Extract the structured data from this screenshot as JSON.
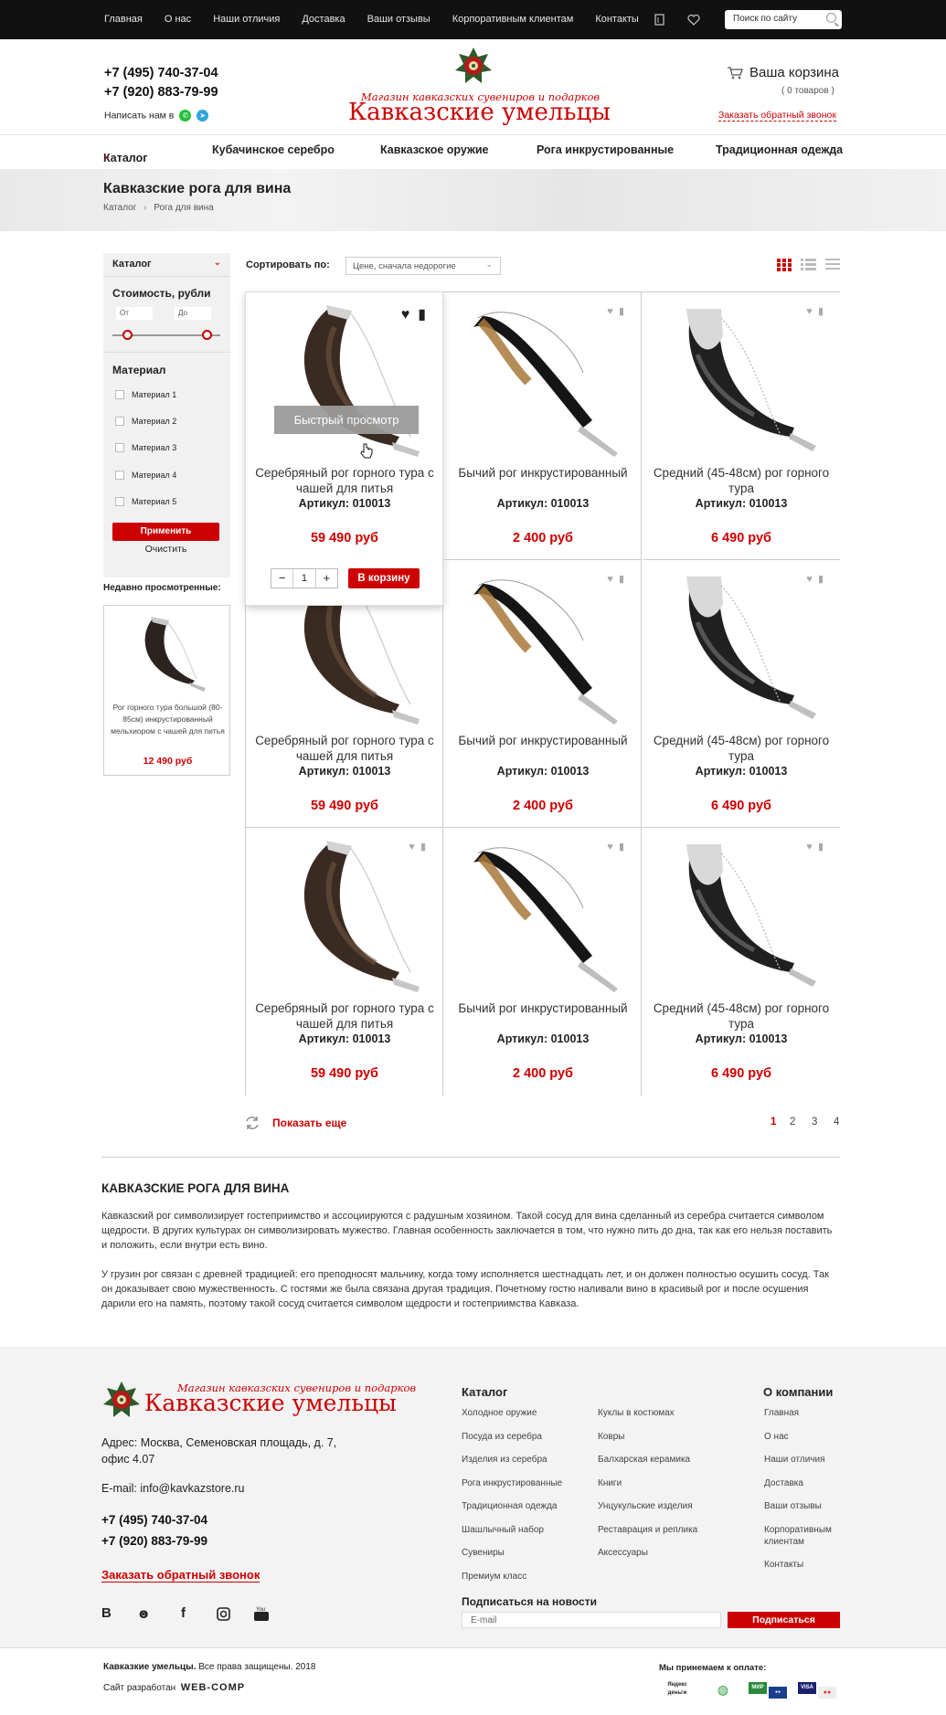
{
  "topnav": [
    "Главная",
    "О нас",
    "Наши отличия",
    "Доставка",
    "Ваши отзывы",
    "Корпоративным клиентам",
    "Контакты"
  ],
  "search": {
    "placeholder": "Поиск по сайту"
  },
  "header": {
    "phone1": "+7 (495) 740-37-04",
    "phone2": "+7 (920) 883-79-99",
    "write_us": "Написать нам в",
    "logo_sub": "Магазин кавказских сувениров и подарков",
    "logo_main": "Кавказские умельцы",
    "cart_label": "Ваша корзина",
    "cart_count": "( 0 товаров )",
    "callback": "Заказать обратный звонок"
  },
  "mainnav": [
    "Каталог",
    "Кубачинское серебро",
    "Кавказское оружие",
    "Рога инкрустированные",
    "Традиционная одежда"
  ],
  "page": {
    "title": "Кавказские рога для вина",
    "crumbs": [
      "Каталог",
      "Рога для вина"
    ]
  },
  "sidebar": {
    "catalog": "Каталог",
    "price_title": "Стоимость, рубли",
    "from": "От",
    "to": "До",
    "material_title": "Материал",
    "materials": [
      "Материал 1",
      "Материал 2",
      "Материал 3",
      "Материал 4",
      "Материал 5"
    ],
    "apply": "Применить",
    "clear": "Очистить",
    "recent_title": "Недавно просмотренные:",
    "recent_name": "Рог горного тура большой (80-85см) инкрустированный мельхиором с чашей для питья",
    "recent_price": "12 490 руб"
  },
  "sort": {
    "label": "Сортировать по:",
    "value": "Цене, сначала недорогие"
  },
  "products": [
    {
      "name": "Серебряный рог горного тура с чашей для питья",
      "sku": "Артикул: 010013",
      "price": "59 490 руб"
    },
    {
      "name": "Бычий рог инкрустированный",
      "sku": "Артикул: 010013",
      "price": "2 400 руб"
    },
    {
      "name": "Средний (45-48см) рог горного тура",
      "sku": "Артикул: 010013",
      "price": "6 490 руб"
    },
    {
      "name": "Серебряный рог горного тура с чашей для питья",
      "sku": "Артикул: 010013",
      "price": "59 490 руб"
    },
    {
      "name": "Бычий рог инкрустированный",
      "sku": "Артикул: 010013",
      "price": "2 400 руб"
    },
    {
      "name": "Средний (45-48см) рог горного тура",
      "sku": "Артикул: 010013",
      "price": "6 490 руб"
    },
    {
      "name": "Серебряный рог горного тура с чашей для питья",
      "sku": "Артикул: 010013",
      "price": "59 490 руб"
    },
    {
      "name": "Бычий рог инкрустированный",
      "sku": "Артикул: 010013",
      "price": "2 400 руб"
    },
    {
      "name": "Средний (45-48см) рог горного тура",
      "sku": "Артикул: 010013",
      "price": "6 490 руб"
    }
  ],
  "hover": {
    "quick_view": "Быстрый просмотр",
    "qty": "1",
    "to_cart": "В корзину",
    "minus": "−",
    "plus": "+"
  },
  "list": {
    "show_more": "Показать еще",
    "pages": [
      "1",
      "2",
      "3",
      "4"
    ],
    "current_page": "1"
  },
  "seo": {
    "title": "КАВКАЗСКИЕ РОГА ДЛЯ ВИНА",
    "p1": "Кавказский рог символизирует гостеприимство и ассоциируются с радушным хозяином. Такой сосуд для вина сделанный из серебра считается символом щедрости. В других культурах он символизировать мужество. Главная особенность заключается в том, что нужно пить до дна, так как его нельзя поставить и положить, если внутри есть вино.",
    "p2": "У грузин рог связан с древней традицией: его преподносят мальчику, когда тому исполняется шестнадцать лет, и он должен полностью осушить сосуд. Так он доказывает свою мужественность. С гостями же была связана другая традиция. Почетному гостю наливали вино в красивый рог и после осушения дарили его на память, поэтому такой сосуд считается символом щедрости и гостеприимства Кавказа."
  },
  "footer": {
    "address": "Адрес: Москва, Семеновская площадь, д. 7, офис 4.07",
    "email": "E-mail:  info@kavkazstore.ru",
    "phone1": "+7 (495) 740-37-04",
    "phone2": "+7 (920) 883-79-99",
    "callback": "Заказать обратный звонок",
    "catalog_title": "Каталог",
    "catalog_col1": [
      "Холодное оружие",
      "Посуда из серебра",
      "Изделия из серебра",
      "Рога инкрустированные",
      "Традиционная одежда",
      "Шашлычный набор",
      "Сувениры",
      "Премиум класс"
    ],
    "catalog_col2": [
      "Куклы в костюмах",
      "Ковры",
      "Балхарская керамика",
      "Книги",
      "Унцукульские изделия",
      "Реставрация и реплика",
      "Аксессуары"
    ],
    "company_title": "О компании",
    "company": [
      "Главная",
      "О нас",
      "Наши отличия",
      "Доставка",
      "Ваши отзывы",
      "Корпоративным клиентам",
      "Контакты"
    ],
    "subscribe_title": "Подписаться на новости",
    "email_placeholder": "E-mail",
    "subscribe_btn": "Подписаться",
    "socials": [
      "B",
      "ok",
      "f",
      "ig",
      "yt"
    ]
  },
  "bottom": {
    "brand": "Кавказкие умельцы.",
    "rights": " Все права защищены. 2018",
    "dev_label": "Сайт разработан",
    "dev_brand": "WEB-COMP",
    "pay_title": "Мы принемаем к оплате:",
    "pay": [
      "Яндекс деньги",
      "Сбербанк",
      "МИР",
      "Maestro",
      "VISA",
      "MasterCard"
    ]
  },
  "colors": {
    "accent": "#cc0000",
    "topbar": "#111111",
    "footer": "#f3f3f3"
  }
}
